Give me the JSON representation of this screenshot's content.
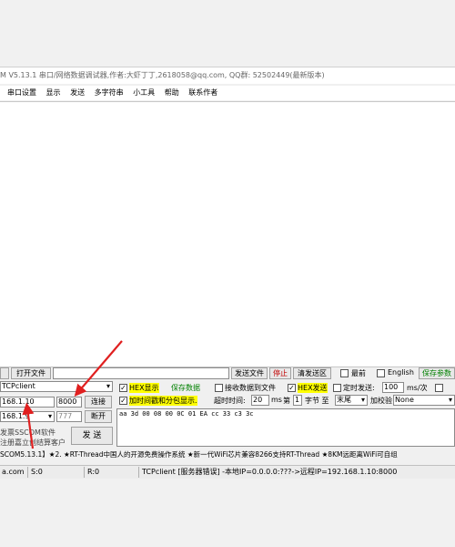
{
  "window": {
    "title": "M V5.13.1 串口/网络数据调试器,作者:大虾丁丁,2618058@qq.com, QQ群: 52502449(最新版本)"
  },
  "menu": {
    "items": [
      "串口设置",
      "显示",
      "发送",
      "多字符串",
      "小工具",
      "帮助",
      "联系作者"
    ]
  },
  "toolbar": {
    "open_file": "打开文件",
    "send_file": "发送文件",
    "stop": "停止",
    "clear_send": "清发送区",
    "last": "最前",
    "english": "English",
    "save_params": "保存参数"
  },
  "network": {
    "mode": "TCPclient",
    "remote_ip": "168.1.10",
    "remote_port": "8000",
    "local_ip": "168.1.9",
    "local_port": "777",
    "connect": "连接",
    "disconnect": "断开"
  },
  "options": {
    "hex_display": "HEX显示",
    "save_data": "保存数据",
    "recv_to_file": "接收数据到文件",
    "hex_send": "HEX发送",
    "timed_send": "定时发送:",
    "interval": "100",
    "interval_unit": "ms/次",
    "add_timestamp": "加时间戳和分包显示.",
    "timeout_label": "超时时间:",
    "timeout_value": "20",
    "timeout_unit": "ms",
    "byte_label": "第",
    "byte_value": "1",
    "byte_unit": "字节 至",
    "tail_value": "末尾",
    "checksum_label": "加校验",
    "checksum_value": "None",
    "hex_display_checked": true,
    "add_timestamp_checked": true,
    "hex_send_checked": true
  },
  "send_area": {
    "content": "aa 3d 00 08 00 0C 01 EA cc 33 c3 3c"
  },
  "send_button": "发 送",
  "side_text": {
    "line1": "发票SSCOM软件",
    "line2": "注册嘉立创结算客户"
  },
  "ticker": "SCOM5.13.1】★2. ★RT-Thread中国人的开源免费操作系统 ★新一代WiFi芯片兼容8266支持RT-Thread ★8KM远距离WiFi可自组",
  "status": {
    "site": "a.com",
    "s": "S:0",
    "r": "R:0",
    "message": "TCPclient [服务器错误] -本地IP=0.0.0.0:???->远程IP=192.168.1.10:8000"
  },
  "colors": {
    "highlight": "#ffff00",
    "arrow": "#e02020",
    "stop_text": "#c00000",
    "save_text": "#008000"
  }
}
